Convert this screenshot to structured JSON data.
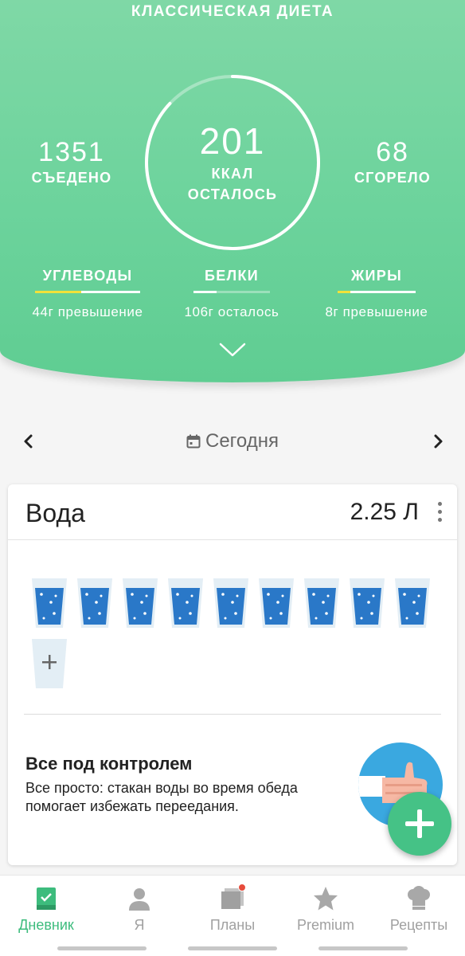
{
  "header": {
    "diet_title": "КЛАССИЧЕСКАЯ ДИЕТА",
    "eaten": {
      "value": "1351",
      "label": "СЪЕДЕНО"
    },
    "remaining": {
      "value": "201",
      "label_line1": "ККАЛ",
      "label_line2": "ОСТАЛОСЬ",
      "progress_fraction": 0.87
    },
    "burned": {
      "value": "68",
      "label": "СГОРЕЛО"
    },
    "macros": [
      {
        "name": "УГЛЕВОДЫ",
        "status": "44г превышение",
        "progress": 1.0,
        "over": true
      },
      {
        "name": "БЕЛКИ",
        "status": "106г осталось",
        "progress": 0.3,
        "over": false
      },
      {
        "name": "ЖИРЫ",
        "status": "8г превышение",
        "progress": 1.0,
        "over": true
      }
    ]
  },
  "date_nav": {
    "label": "Сегодня"
  },
  "water": {
    "title": "Вода",
    "amount": "2.25 Л",
    "glasses_filled": 9,
    "glasses_total": 10,
    "tip_title": "Все под контролем",
    "tip_text": "Все просто: стакан воды во время обеда помогает избежать переедания."
  },
  "tabs": [
    {
      "label": "Дневник",
      "icon": "diary-book-icon",
      "active": true
    },
    {
      "label": "Я",
      "icon": "person-icon",
      "active": false
    },
    {
      "label": "Планы",
      "icon": "plans-icon",
      "active": false,
      "badge": true
    },
    {
      "label": "Premium",
      "icon": "star-icon",
      "active": false
    },
    {
      "label": "Рецепты",
      "icon": "chef-hat-icon",
      "active": false
    }
  ],
  "colors": {
    "accent_green": "#45c286",
    "header_green": "#6cd39c",
    "warning_yellow": "#f2e13a",
    "water_blue": "#2a78c8",
    "badge_red": "#e74c3c"
  }
}
